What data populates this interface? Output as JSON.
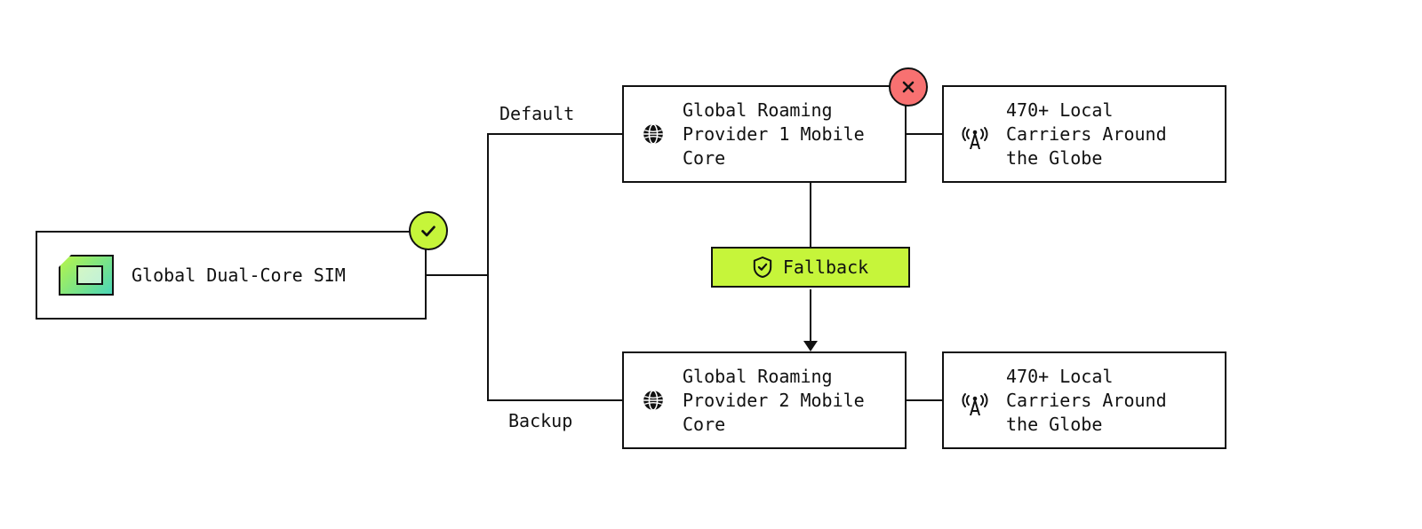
{
  "sim": {
    "label": "Global Dual-Core SIM"
  },
  "paths": {
    "default_label": "Default",
    "backup_label": "Backup"
  },
  "provider1": {
    "title": "Global Roaming Provider 1 Mobile Core"
  },
  "provider2": {
    "title": "Global Roaming Provider 2 Mobile Core"
  },
  "carriers": {
    "text": "470+ Local Carriers Around the Globe"
  },
  "fallback": {
    "label": "Fallback"
  },
  "status": {
    "sim": "ok",
    "provider1": "error"
  },
  "colors": {
    "accent_lime": "#C6F53A",
    "error_red": "#F87171",
    "sim_gradient_start": "#B7F54A",
    "sim_gradient_end": "#4AD6B8"
  }
}
